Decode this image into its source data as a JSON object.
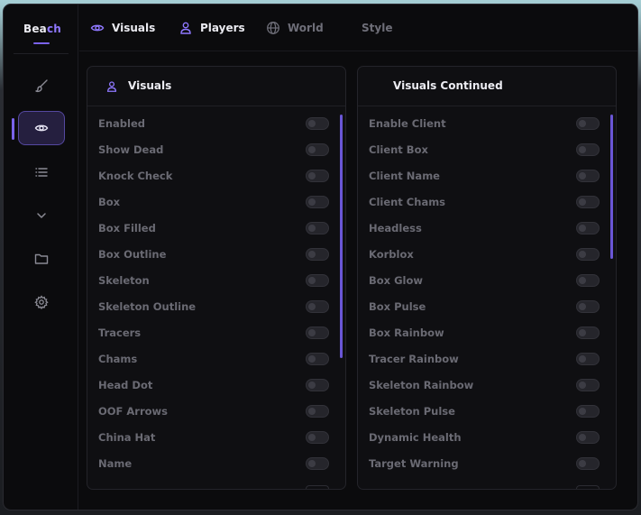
{
  "brand": {
    "prefix": "Bea",
    "accent_part": "ch"
  },
  "colors": {
    "accent": "#7a63ea",
    "panel_bg": "#0f0f12",
    "window_bg": "#0b0b0d"
  },
  "sidebar": {
    "items": [
      {
        "icon": "brush-icon",
        "active": false
      },
      {
        "icon": "eye-icon",
        "active": true
      },
      {
        "icon": "list-icon",
        "active": false
      },
      {
        "icon": "chevron-down-icon",
        "active": false
      },
      {
        "icon": "folder-icon",
        "active": false
      },
      {
        "icon": "gear-icon",
        "active": false
      }
    ]
  },
  "tabs": [
    {
      "label": "Visuals",
      "icon": "eye-icon",
      "active": true
    },
    {
      "label": "Players",
      "icon": "user-icon",
      "active": true
    },
    {
      "label": "World",
      "icon": "globe-icon",
      "active": false
    },
    {
      "label": "Style",
      "icon": "",
      "active": false
    }
  ],
  "left_panel": {
    "title": "Visuals",
    "icon": "user-icon",
    "rows": [
      {
        "label": "Enabled",
        "on": false
      },
      {
        "label": "Show Dead",
        "on": false
      },
      {
        "label": "Knock Check",
        "on": false
      },
      {
        "label": "Box",
        "on": false
      },
      {
        "label": "Box Filled",
        "on": false
      },
      {
        "label": "Box Outline",
        "on": false
      },
      {
        "label": "Skeleton",
        "on": false
      },
      {
        "label": "Skeleton Outline",
        "on": false
      },
      {
        "label": "Tracers",
        "on": false
      },
      {
        "label": "Chams",
        "on": false
      },
      {
        "label": "Head Dot",
        "on": false
      },
      {
        "label": "OOF Arrows",
        "on": false
      },
      {
        "label": "China Hat",
        "on": false
      },
      {
        "label": "Name",
        "on": false
      }
    ]
  },
  "right_panel": {
    "title": "Visuals Continued",
    "rows": [
      {
        "label": "Enable Client",
        "on": false
      },
      {
        "label": "Client Box",
        "on": false
      },
      {
        "label": "Client Name",
        "on": false
      },
      {
        "label": "Client Chams",
        "on": false
      },
      {
        "label": "Headless",
        "on": false
      },
      {
        "label": "Korblox",
        "on": false
      },
      {
        "label": "Box Glow",
        "on": false
      },
      {
        "label": "Box Pulse",
        "on": false
      },
      {
        "label": "Box Rainbow",
        "on": false
      },
      {
        "label": "Tracer Rainbow",
        "on": false
      },
      {
        "label": "Skeleton Rainbow",
        "on": false
      },
      {
        "label": "Skeleton Pulse",
        "on": false
      },
      {
        "label": "Dynamic Health",
        "on": false
      },
      {
        "label": "Target Warning",
        "on": false
      }
    ]
  }
}
